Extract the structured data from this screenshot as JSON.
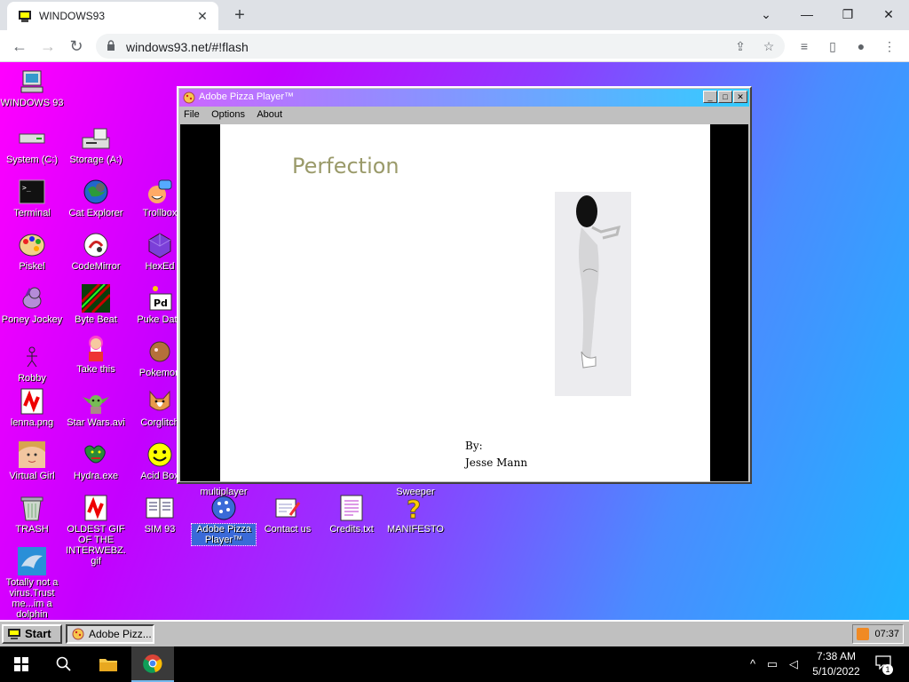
{
  "browser": {
    "tab_title": "WINDOWS93",
    "tab_close": "✕",
    "new_tab": "+",
    "url": "windows93.net/#!flash",
    "minimize": "⌄",
    "restore": "—",
    "maximize": "❐",
    "close": "✕"
  },
  "desktop": {
    "icons": [
      {
        "label": "WINDOWS 93"
      },
      {
        "label": "System (C:)"
      },
      {
        "label": "Storage (A:)"
      },
      {
        "label": "Terminal"
      },
      {
        "label": "Cat Explorer"
      },
      {
        "label": "Trollbox"
      },
      {
        "label": "Piskel"
      },
      {
        "label": "CodeMirror"
      },
      {
        "label": "HexEd"
      },
      {
        "label": "Poney Jockey"
      },
      {
        "label": "Byte Beat"
      },
      {
        "label": "Puke Data"
      },
      {
        "label": "Robby"
      },
      {
        "label": "Take this"
      },
      {
        "label": "Pokemon"
      },
      {
        "label": "lenna.png"
      },
      {
        "label": "Star Wars.avi"
      },
      {
        "label": "Corglitch"
      },
      {
        "label": "Virtual Girl"
      },
      {
        "label": "Hydra.exe"
      },
      {
        "label": "Acid Box"
      },
      {
        "label": "TRASH"
      },
      {
        "label": "OLDEST GIF OF THE INTERWEBZ.gif"
      },
      {
        "label": "SIM 93"
      },
      {
        "label": "Adobe Pizza Player™"
      },
      {
        "label": "Contact us"
      },
      {
        "label": "Credits.txt"
      },
      {
        "label": "MANIFESTO"
      },
      {
        "label": "Totally not a virus.Trust me...im a dolphin"
      },
      {
        "label": "multiplayer"
      },
      {
        "label": "Sweeper"
      }
    ]
  },
  "window": {
    "title": "Adobe Pizza Player™",
    "menu": [
      "File",
      "Options",
      "About"
    ],
    "stage_title": "Perfection",
    "stage_by": "By:",
    "stage_author": "Jesse Mann"
  },
  "w93_taskbar": {
    "start": "Start",
    "task": "Adobe Pizz...",
    "tray_time": "07:37"
  },
  "win10_taskbar": {
    "time": "7:38 AM",
    "date": "5/10/2022",
    "notifications": "1"
  }
}
